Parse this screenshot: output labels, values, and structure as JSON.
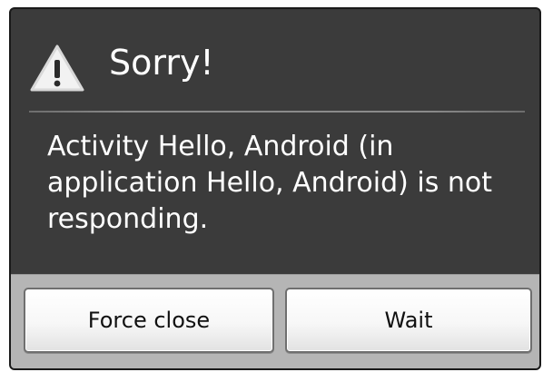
{
  "dialog": {
    "title": "Sorry!",
    "icon": "warning-icon",
    "message": "Activity Hello, Android (in application Hello, Android) is not responding."
  },
  "buttons": {
    "force_close_label": "Force close",
    "wait_label": "Wait"
  },
  "colors": {
    "dialog_background": "#3b3b3b",
    "button_bar": "#b5b5b5",
    "text_light": "#ffffff",
    "text_dark": "#111111"
  }
}
